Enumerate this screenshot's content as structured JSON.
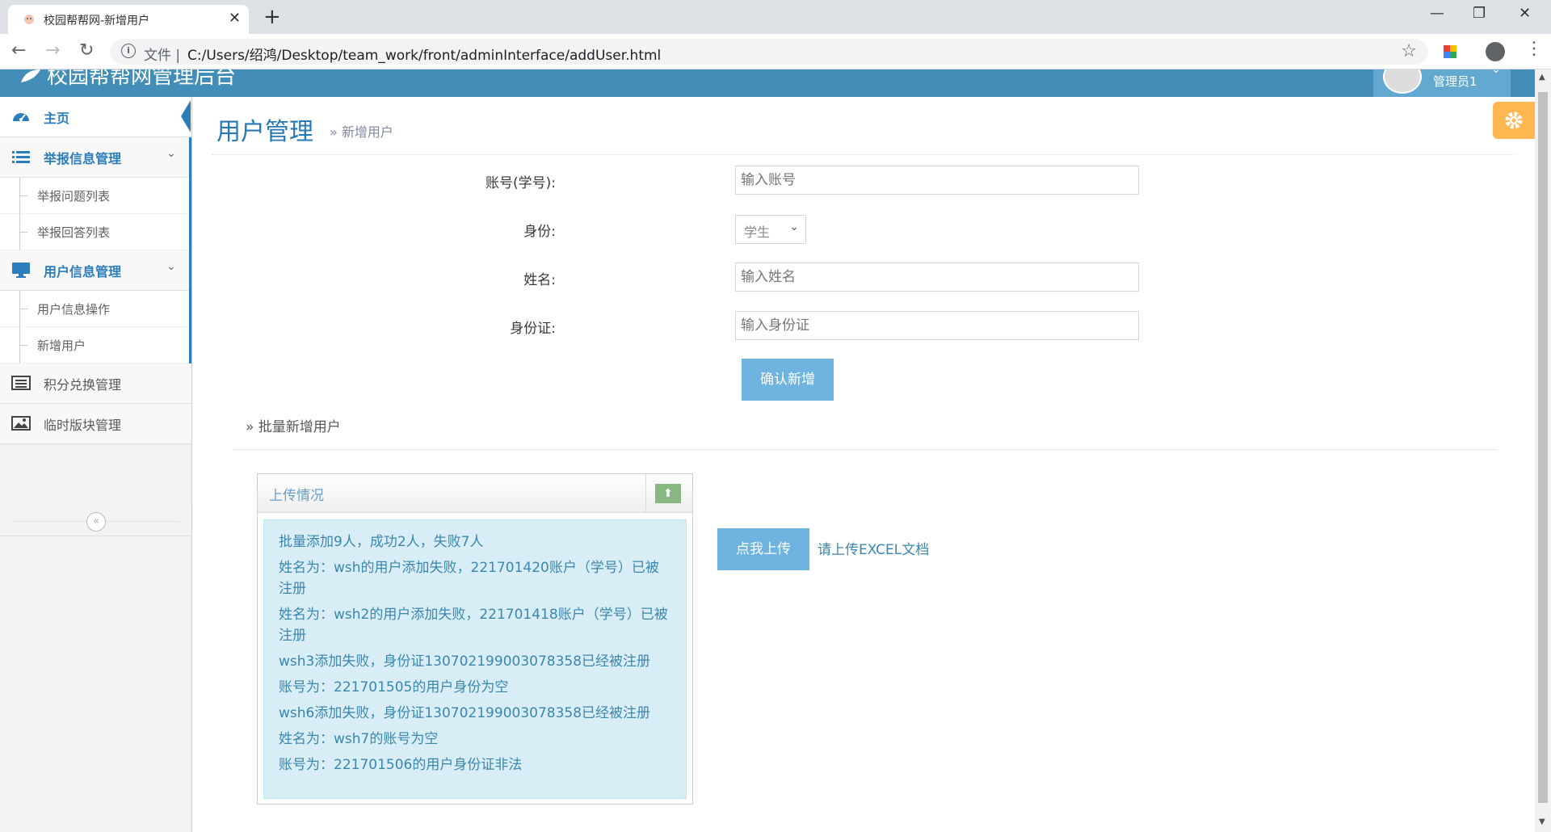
{
  "browser": {
    "tab_title": "校园帮帮网-新增用户",
    "tab_close": "✕",
    "new_tab": "+",
    "win_min": "—",
    "win_restore": "❐",
    "win_close": "✕",
    "back": "←",
    "forward": "→",
    "reload": "↻",
    "file_label": "文件 |",
    "url": "C:/Users/绍鸿/Desktop/team_work/front/adminInterface/addUser.html",
    "star": "☆",
    "menu": "⋮"
  },
  "header": {
    "brand": "校园帮帮网管理后台",
    "user_name": "管理员1",
    "caret": "⌄"
  },
  "sidebar": {
    "home": "主页",
    "report_mgmt": "举报信息管理",
    "report_sub": [
      "举报问题列表",
      "举报回答列表"
    ],
    "user_mgmt": "用户信息管理",
    "user_sub": [
      "用户信息操作",
      "新增用户"
    ],
    "points_mgmt": "积分兑换管理",
    "temp_mgmt": "临时版块管理",
    "chevron": "⌄",
    "collapse": "«"
  },
  "page_header": {
    "title": "用户管理",
    "subtitle": "» 新增用户"
  },
  "form": {
    "account_label": "账号(学号):",
    "account_placeholder": "输入账号",
    "identity_label": "身份:",
    "identity_value": "学生",
    "name_label": "姓名:",
    "name_placeholder": "输入姓名",
    "id_card_label": "身份证:",
    "id_card_placeholder": "输入身份证",
    "confirm_button": "确认新增"
  },
  "batch": {
    "link": "» 批量新增用户",
    "box_title": "上传情况",
    "toggle": "⬆",
    "messages": [
      "批量添加9人，成功2人，失败7人",
      "姓名为：wsh的用户添加失败，221701420账户（学号）已被注册",
      "姓名为：wsh2的用户添加失败，221701418账户（学号）已被注册",
      "wsh3添加失败，身份证130702199003078358已经被注册",
      "账号为：221701505的用户身份为空",
      "wsh6添加失败，身份证130702199003078358已经被注册",
      "姓名为：wsh7的账号为空",
      "账号为：221701506的用户身份证非法"
    ],
    "upload_button": "点我上传",
    "upload_hint": "请上传EXCEL文档"
  },
  "back_to_top": "︽"
}
